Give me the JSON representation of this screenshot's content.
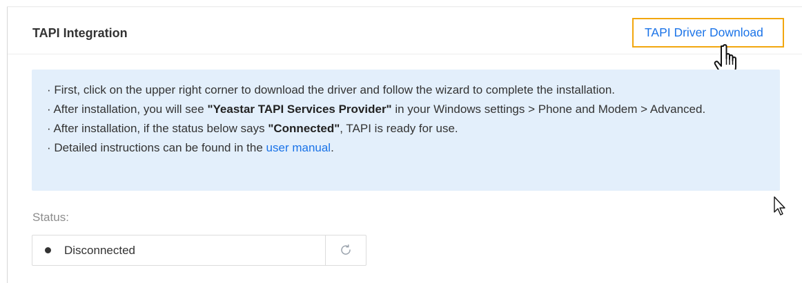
{
  "card": {
    "title": "TAPI Integration",
    "download_link": "TAPI Driver Download"
  },
  "info": {
    "line1": "· First, click on the upper right corner to download the driver and follow the wizard to complete the installation.",
    "line2_prefix": "· After installation, you will see ",
    "line2_bold": "\"Yeastar TAPI Services Provider\"",
    "line2_suffix": " in your Windows settings > Phone and Modem > Advanced.",
    "line3_prefix": "· After installation, if the status below says ",
    "line3_bold": "\"Connected\"",
    "line3_suffix": ", TAPI is ready for use.",
    "line4_prefix": "· Detailed instructions can be found in the ",
    "line4_link": "user manual",
    "line4_suffix": "."
  },
  "status": {
    "label": "Status:",
    "value": "Disconnected"
  },
  "icons": {
    "refresh": "refresh-icon",
    "hand_cursor": "hand-pointer-cursor",
    "arrow_cursor": "arrow-pointer-cursor"
  },
  "colors": {
    "link": "#1a73e8",
    "highlight_border": "#f2a60d",
    "info_background": "#e3effb"
  }
}
